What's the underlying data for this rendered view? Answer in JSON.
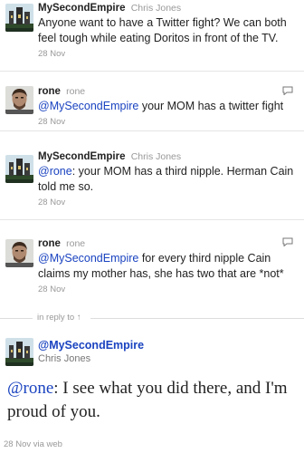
{
  "tweets": [
    {
      "name": "MySecondEmpire",
      "handle": "Chris Jones",
      "text": "Anyone want to have a Twitter fight? We can both feel tough while eating Doritos in front of the TV.",
      "time": "28 Nov",
      "avatar": "castle-avatar"
    },
    {
      "name": "rone",
      "handle": "rone",
      "mention": "@MySecondEmpire",
      "text": " your MOM has a twitter fight",
      "time": "28 Nov",
      "avatar": "man-avatar"
    },
    {
      "name": "MySecondEmpire",
      "handle": "Chris Jones",
      "mention": "@rone",
      "text": ": your MOM has a third nipple. Herman Cain told me so.",
      "time": "28 Nov",
      "avatar": "castle-avatar"
    },
    {
      "name": "rone",
      "handle": "rone",
      "mention": "@MySecondEmpire",
      "text": " for every third nipple Cain claims my mother has, she has two that are *not*",
      "time": "28 Nov",
      "avatar": "man-avatar"
    }
  ],
  "in_reply_to": "in reply to ↑",
  "focus": {
    "name": "@MySecondEmpire",
    "subname": "Chris Jones",
    "mention": "@rone",
    "text": ": I see what you did there, and I'm proud of you.",
    "meta": "28 Nov via web"
  },
  "colors": {
    "mention": "#1a43c0",
    "muted": "#999999",
    "divider": "#e5e5e5"
  }
}
